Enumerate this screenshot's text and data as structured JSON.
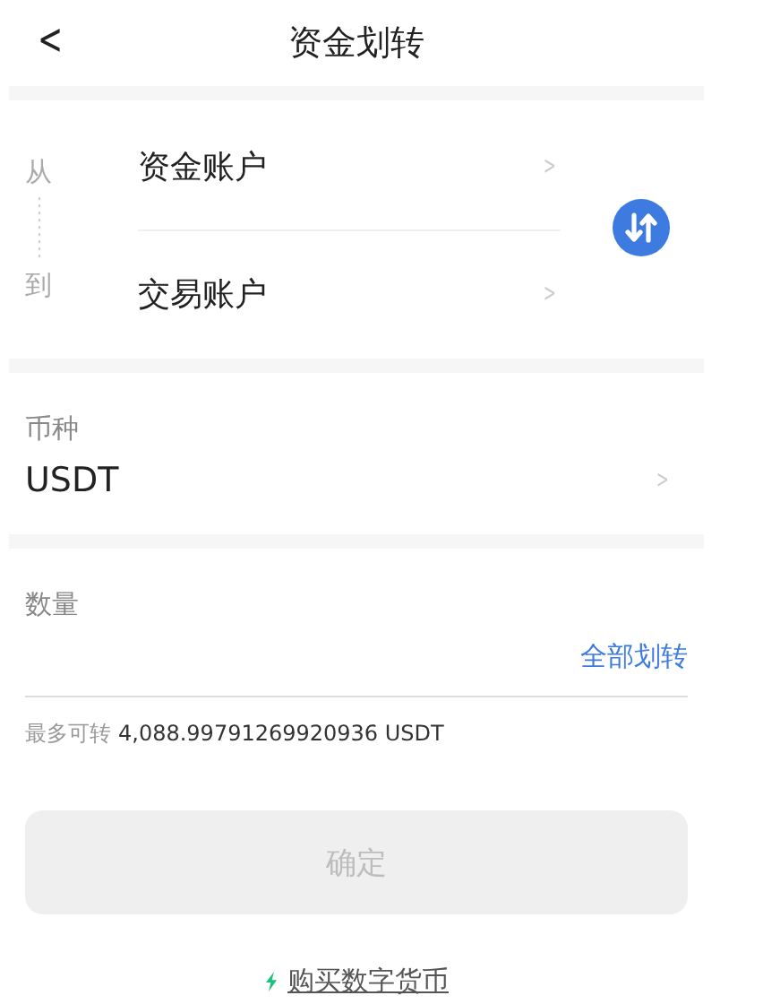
{
  "header": {
    "back": "<",
    "title": "资金划转"
  },
  "transfer": {
    "from_label": "从",
    "to_label": "到",
    "accounts": [
      {
        "name": "资金账户",
        "chevron": ">"
      },
      {
        "name": "交易账户",
        "chevron": ">"
      }
    ]
  },
  "currency": {
    "label": "币种",
    "value": "USDT",
    "chevron": ">"
  },
  "amount": {
    "label": "数量",
    "all_button": "全部划转",
    "max_label": "最多可转",
    "max_value": "4,088.99791269920936 USDT"
  },
  "confirm": {
    "label": "确定",
    "disabled": true
  },
  "buy_link": "购买数字货币"
}
